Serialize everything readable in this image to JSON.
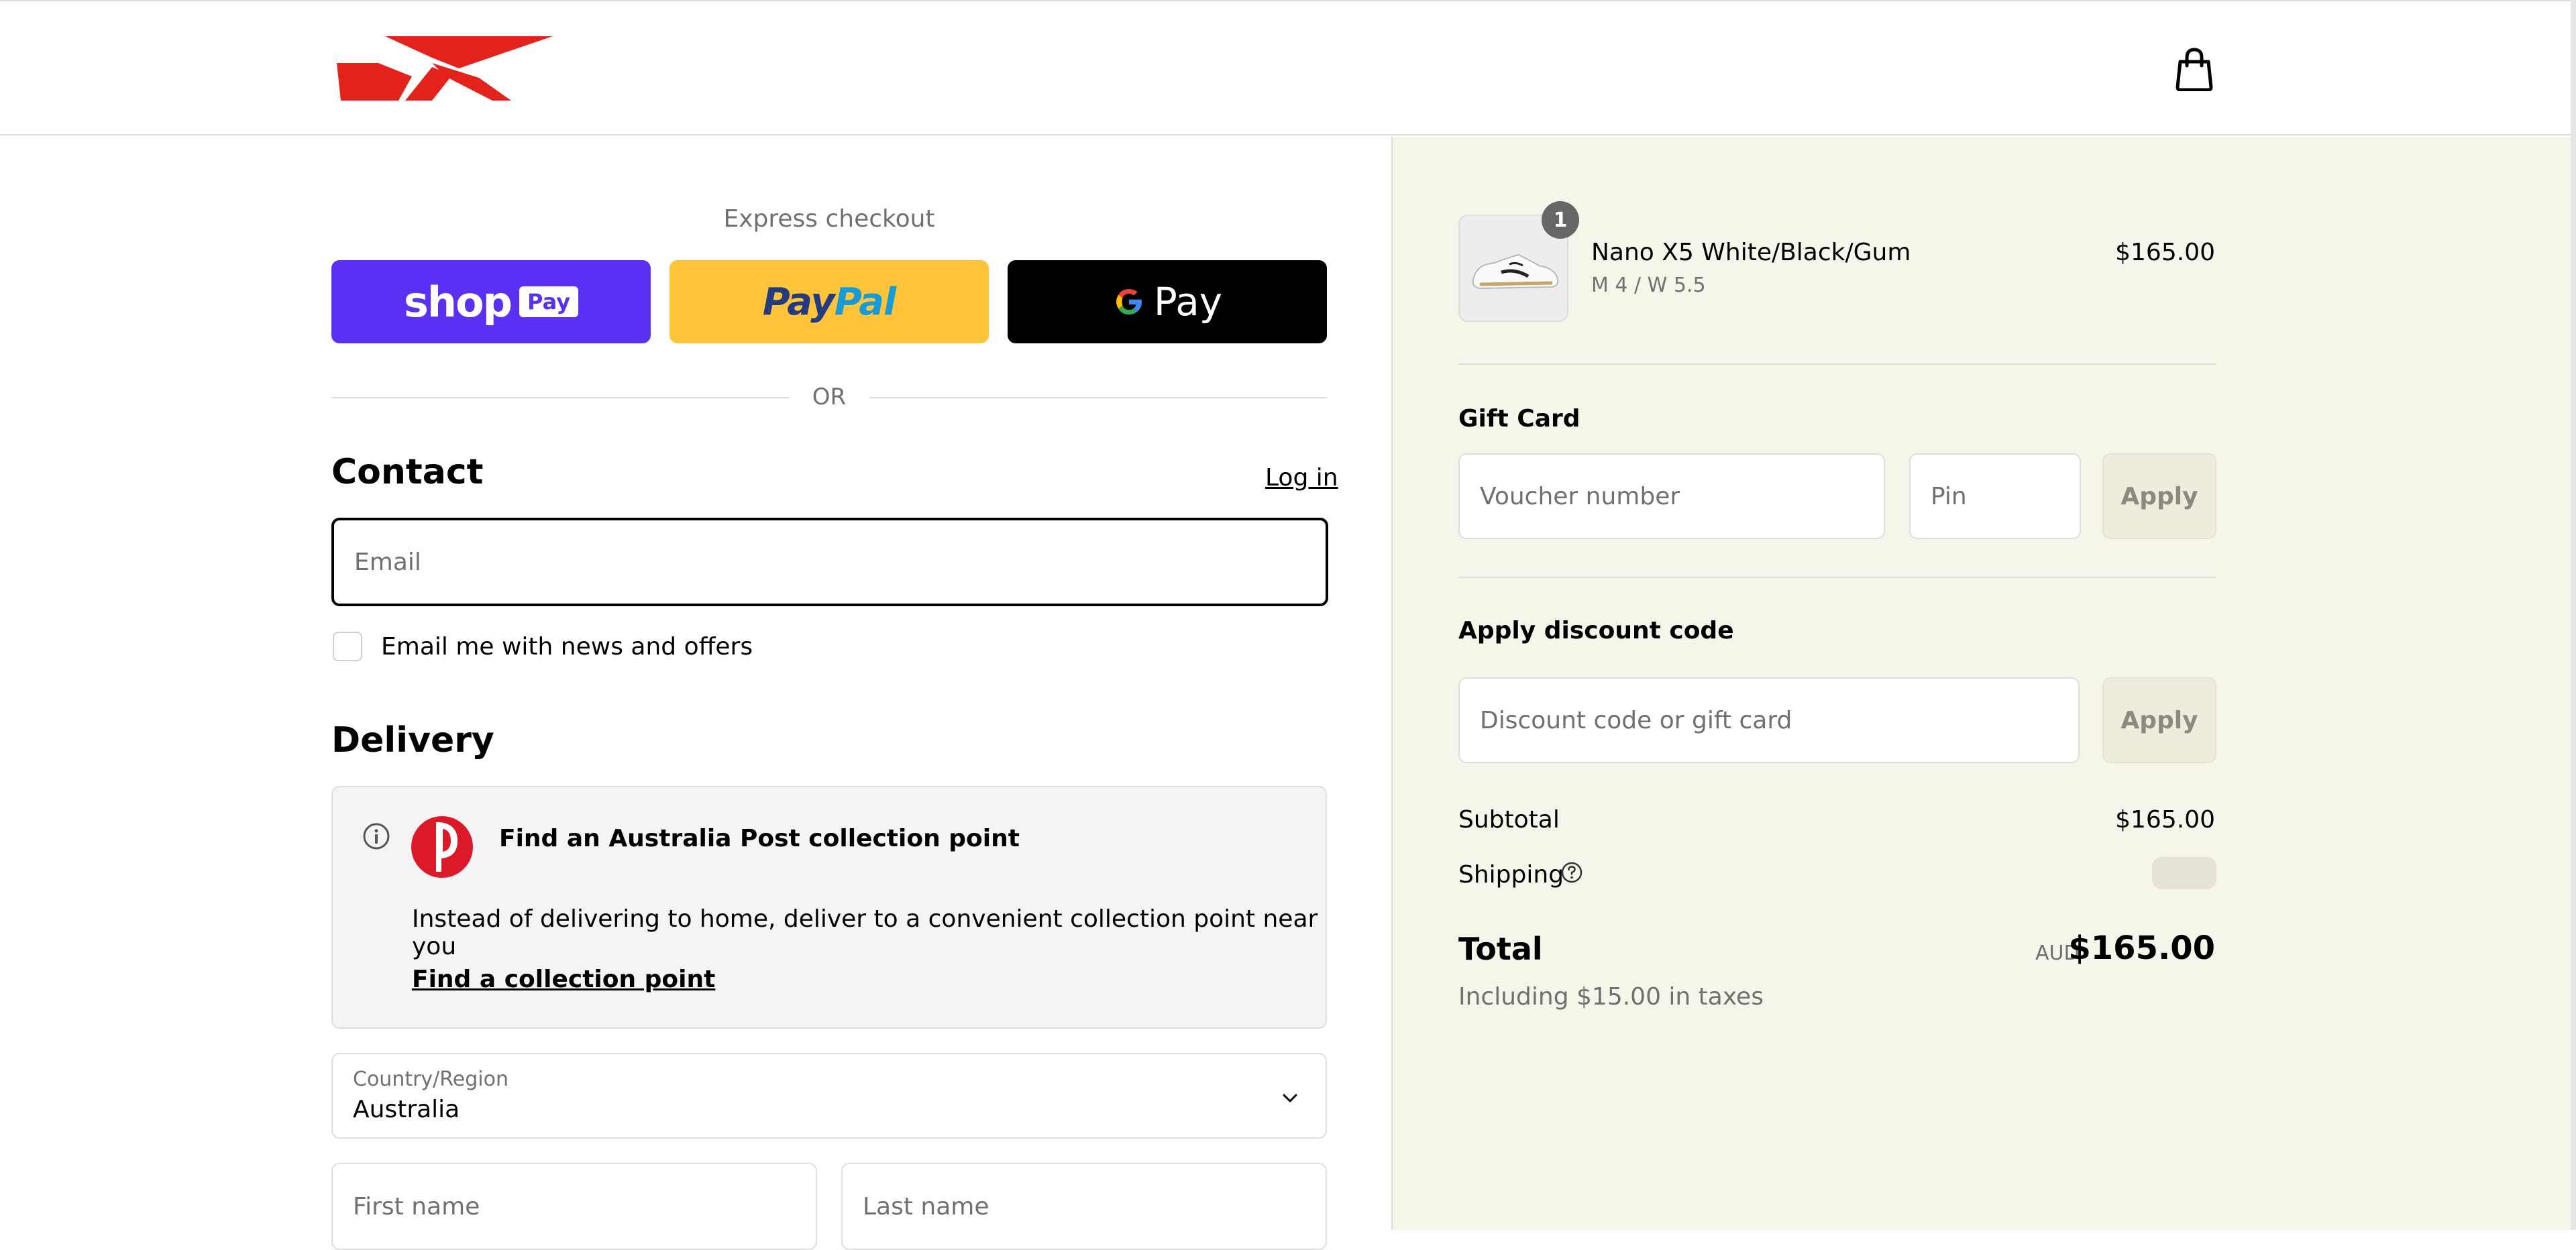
{
  "brand": {
    "logo_icon": "reebok-delta-logo",
    "accent": "#e3231b"
  },
  "header": {
    "cart_icon": "shopping-bag-icon"
  },
  "express": {
    "title": "Express checkout",
    "shop_pay": {
      "word": "shop",
      "badge": "Pay",
      "color": "#5a31f4"
    },
    "paypal": {
      "word1": "Pay",
      "word2": "Pal",
      "color": "#ffc439"
    },
    "gpay": {
      "word": "Pay",
      "color": "#000000"
    },
    "or": "OR"
  },
  "contact": {
    "title": "Contact",
    "login": "Log in",
    "email_placeholder": "Email",
    "newsletter_label": "Email me with news and offers"
  },
  "delivery": {
    "title": "Delivery",
    "notice": {
      "title": "Find an Australia Post collection point",
      "body": "Instead of delivering to home, deliver to a convenient collection point near you",
      "link": "Find a collection point"
    },
    "country": {
      "label": "Country/Region",
      "value": "Australia"
    },
    "first_name_placeholder": "First name",
    "last_name_placeholder": "Last name"
  },
  "summary": {
    "item": {
      "qty": "1",
      "name": "Nano X5 White/Black/Gum",
      "variant": "M 4 / W 5.5",
      "price": "$165.00"
    },
    "gift_card": {
      "title": "Gift Card",
      "voucher_placeholder": "Voucher number",
      "pin_placeholder": "Pin",
      "apply": "Apply"
    },
    "discount": {
      "title": "Apply discount code",
      "placeholder": "Discount code or gift card",
      "apply": "Apply"
    },
    "subtotal_label": "Subtotal",
    "subtotal_value": "$165.00",
    "shipping_label": "Shipping",
    "total_label": "Total",
    "currency": "AUD",
    "total_value": "$165.00",
    "taxes": "Including $15.00 in taxes"
  }
}
